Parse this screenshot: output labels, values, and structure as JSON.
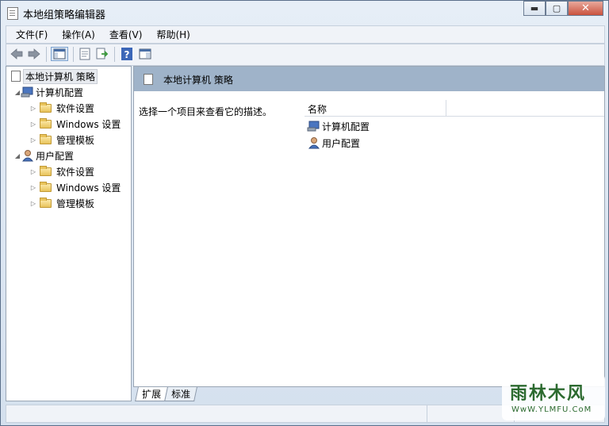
{
  "window": {
    "title": "本地组策略编辑器",
    "minimize": "▬",
    "maximize": "▢",
    "close": "✕"
  },
  "menu": [
    "文件(F)",
    "操作(A)",
    "查看(V)",
    "帮助(H)"
  ],
  "toolbar": {
    "icons": [
      "back-icon",
      "forward-icon",
      "show-hide-tree-icon",
      "properties-icon",
      "export-list-icon",
      "help-icon",
      "show-hide-action-pane-icon"
    ]
  },
  "tree": {
    "root": "本地计算机 策略",
    "computer": {
      "label": "计算机配置",
      "children": [
        "软件设置",
        "Windows 设置",
        "管理模板"
      ]
    },
    "user": {
      "label": "用户配置",
      "children": [
        "软件设置",
        "Windows 设置",
        "管理模板"
      ]
    }
  },
  "content": {
    "header": "本地计算机 策略",
    "description": "选择一个项目来查看它的描述。",
    "column_name": "名称",
    "items": [
      "计算机配置",
      "用户配置"
    ]
  },
  "tabs": [
    "扩展",
    "标准"
  ],
  "watermark": {
    "title": "雨林木风",
    "url": "WwW.YLMFU.CoM"
  },
  "colors": {
    "header_band": "#9fb3c9",
    "window_bg": "#d4e0ee"
  }
}
